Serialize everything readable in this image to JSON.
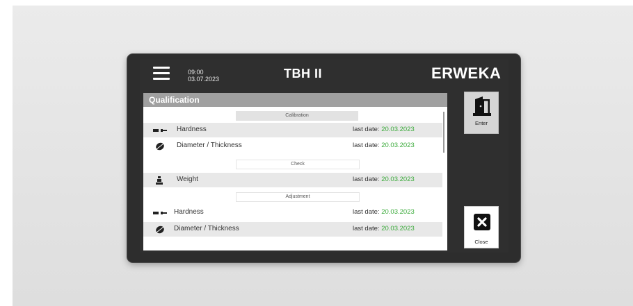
{
  "header": {
    "time": "09:00",
    "date": "03.07.2023",
    "title": "TBH II",
    "logo": "ERWEKA"
  },
  "panel": {
    "title": "Qualification",
    "sections": {
      "calibration": "Calibration",
      "check": "Check",
      "adjustment": "Adjustment"
    },
    "last_date_label": "last date:",
    "rows": [
      {
        "icon": "hardness-icon",
        "name": "Hardness",
        "date": "20.03.2023"
      },
      {
        "icon": "diameter-thickness-icon",
        "name": "Diameter / Thickness",
        "date": "20.03.2023"
      },
      {
        "icon": "weight-icon",
        "name": "Weight",
        "date": "20.03.2023"
      },
      {
        "icon": "hardness-icon",
        "name": "Hardness",
        "date": "20.03.2023"
      },
      {
        "icon": "diameter-thickness-icon",
        "name": "Diameter / Thickness",
        "date": "20.03.2023"
      }
    ]
  },
  "buttons": {
    "enter": {
      "label": "Enter",
      "icon": "door-exit-icon"
    },
    "close": {
      "label": "Close",
      "icon": "close-x-icon"
    }
  },
  "colors": {
    "bezel": "#2d2d2d",
    "panel_header": "#a0a0a0",
    "date_green": "#3aaa3a"
  }
}
